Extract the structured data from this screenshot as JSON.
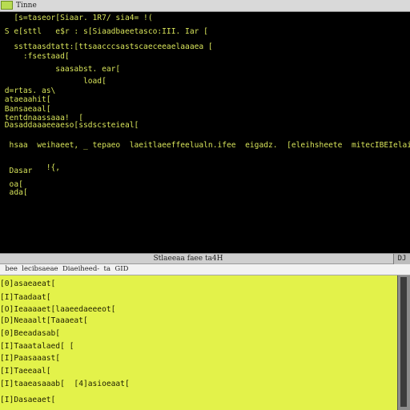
{
  "top_window": {
    "title": "Tinne",
    "lines": [
      "   [s=taseor[Siaar. 1R7/ sia4= !(",
      " S e[sttl   e$r : s[Siaadbaeetasco:III. Iar [",
      "   ssttaasdtatt:[ttsaacccsastscaeceeaelaaaea [",
      "     :fsestaad[",
      "            saasabst. ear[",
      "                  load[",
      " d=rtas. as\\",
      " ataeaahit[",
      " Bansaeaal[",
      " tentdnaassaaa!  [",
      " Dasaddaaaeeaeso[ssdscsteieal[",
      "    ",
      "  hsaa  weihaeet, _ tepaeo  laeitlaeeffeelualn.ifee  eigadz.  [eleihsheete  mitecIBEIelai.",
      "   ",
      "  Dasar",
      "          !{,",
      "  oa[",
      "  ada["
    ]
  },
  "bottom_window": {
    "title": "Stlaeeaa faee ta4H",
    "close_label": "DJ",
    "menu_text": "  bee  lecibsaeae  Diaeiheed-  ta  GID",
    "lines": [
      "[0]asaeaeat[",
      "[I]Taadaat[",
      "[O]Ieaaaaet[laaeedaeeeot[",
      "[D]Neaaalt[Taaaeat[",
      "[0]Beeadasab[",
      "[I]Taaatalaed[ [",
      "[I]Paasaaast[",
      "[I]Taeeaal[",
      "[I]taaeasaaab[  [4]asioeaat[",
      "[I]Dasaeaet["
    ]
  }
}
